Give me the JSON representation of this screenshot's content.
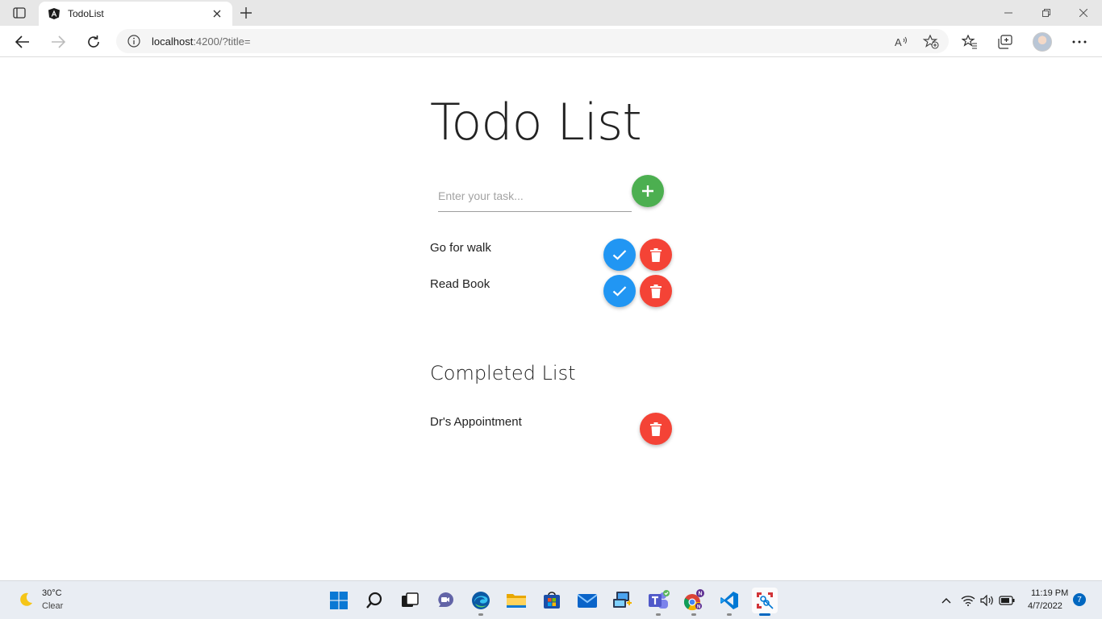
{
  "browser": {
    "tab": {
      "title": "TodoList"
    },
    "address": {
      "host": "localhost",
      "rest": ":4200/?title="
    }
  },
  "app": {
    "title": "Todo List",
    "input": {
      "placeholder": "Enter your task..."
    },
    "todo_items": [
      {
        "label": "Go for walk"
      },
      {
        "label": "Read Book"
      }
    ],
    "completed_title": "Completed List",
    "completed_items": [
      {
        "label": "Dr's Appointment"
      }
    ],
    "colors": {
      "add": "#4caf50",
      "done": "#2196f3",
      "delete": "#f44336"
    }
  },
  "taskbar": {
    "weather": {
      "temp": "30°C",
      "desc": "Clear"
    },
    "clock": {
      "time": "11:19 PM",
      "date": "4/7/2022"
    },
    "notifications": "7",
    "apps": [
      "start-icon",
      "search-icon",
      "task-view-icon",
      "chat-icon",
      "edge-icon",
      "file-explorer-icon",
      "store-icon",
      "mail-icon",
      "remote-desktop-icon",
      "teams-icon",
      "chrome-icon",
      "vscode-icon",
      "snipping-tool-icon"
    ]
  }
}
